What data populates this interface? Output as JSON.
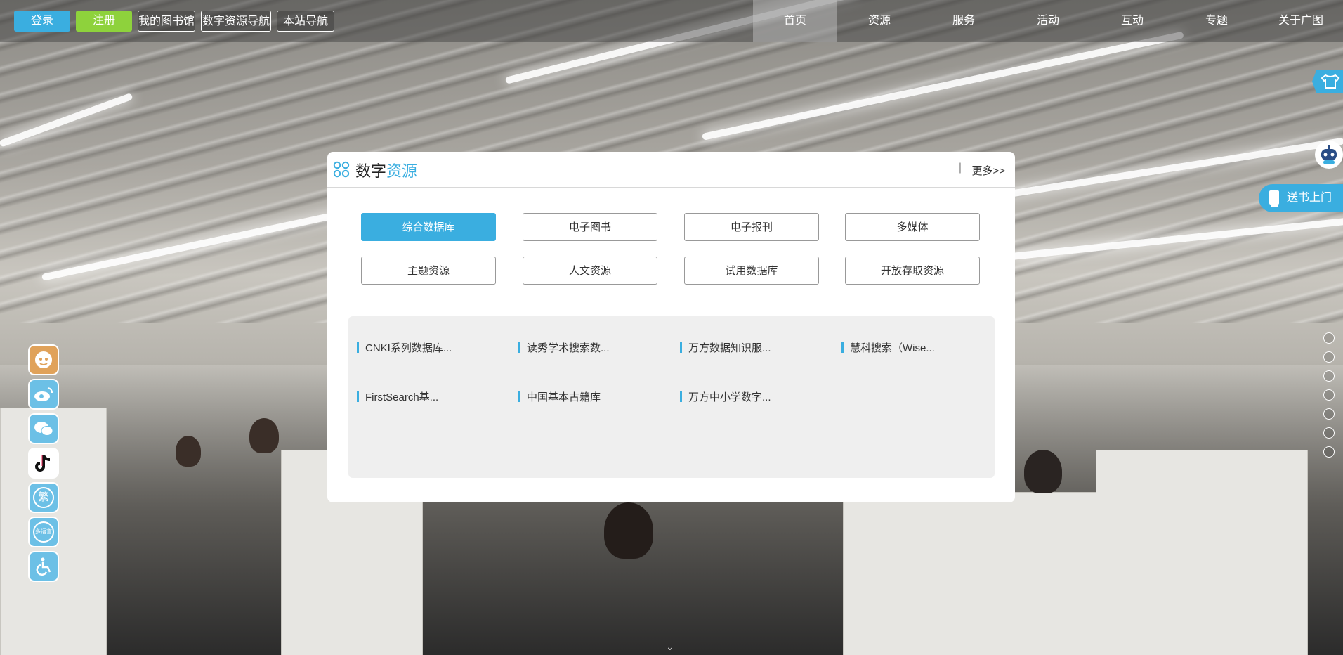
{
  "topbar": {
    "login": "登录",
    "register": "注册",
    "my_library": "我的图书馆",
    "digital_nav": "数字资源导航",
    "site_nav": "本站导航"
  },
  "nav": {
    "items": [
      "首页",
      "资源",
      "服务",
      "活动",
      "互动",
      "专题",
      "关于广图"
    ],
    "active_index": 0
  },
  "panel": {
    "title_main": "数字",
    "title_accent": "资源",
    "separator": "|",
    "more": "更多>>",
    "categories": [
      "综合数据库",
      "电子图书",
      "电子报刊",
      "多媒体",
      "主题资源",
      "人文资源",
      "试用数据库",
      "开放存取资源"
    ],
    "active_category": 0,
    "resources": [
      "CNKI系列数据库...",
      "读秀学术搜索数...",
      "万方数据知识服...",
      "慧科搜索（Wise...",
      "FirstSearch基...",
      "中国基本古籍库",
      "万方中小学数字..."
    ]
  },
  "left_icons": {
    "traditional": "繁",
    "multilang": "多语言"
  },
  "right": {
    "deliver": "送书上门"
  },
  "colors": {
    "accent": "#3aaee0",
    "register_green": "#8ed23c"
  }
}
